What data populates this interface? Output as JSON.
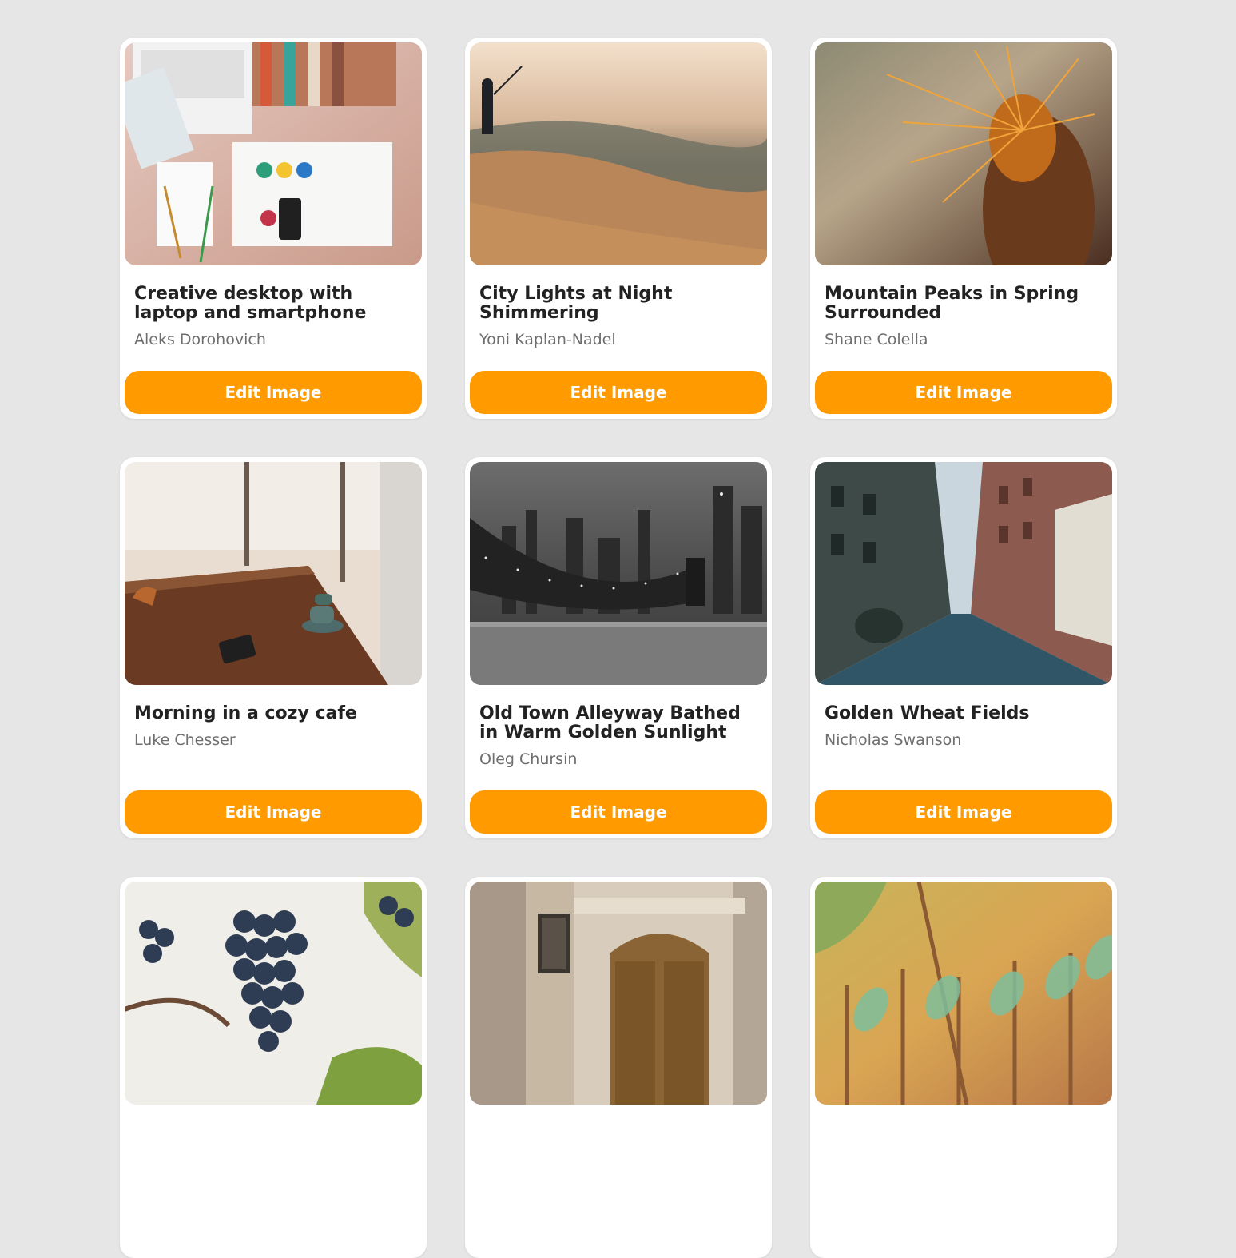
{
  "accent_color": "#ff9a00",
  "cards": [
    {
      "title": "Creative desktop with laptop and smartphone",
      "author": "Aleks Dorohovich",
      "button": "Edit Image",
      "image": "desk-photo"
    },
    {
      "title": "City Lights at Night Shimmering",
      "author": "Yoni Kaplan-Nadel",
      "button": "Edit Image",
      "image": "seaside-photo"
    },
    {
      "title": "Mountain Peaks in Spring Surrounded",
      "author": "Shane Colella",
      "button": "Edit Image",
      "image": "cactus-photo"
    },
    {
      "title": "Morning in a cozy cafe",
      "author": "Luke Chesser",
      "button": "Edit Image",
      "image": "cafe-photo"
    },
    {
      "title": "Old Town Alleyway Bathed in Warm Golden Sunlight",
      "author": "Oleg Chursin",
      "button": "Edit Image",
      "image": "bridge-photo"
    },
    {
      "title": "Golden Wheat Fields",
      "author": "Nicholas Swanson",
      "button": "Edit Image",
      "image": "street-photo"
    },
    {
      "title": "",
      "author": "",
      "button": "",
      "image": "grapes-photo"
    },
    {
      "title": "",
      "author": "",
      "button": "",
      "image": "door-photo"
    },
    {
      "title": "",
      "author": "",
      "button": "",
      "image": "bottles-photo"
    }
  ]
}
